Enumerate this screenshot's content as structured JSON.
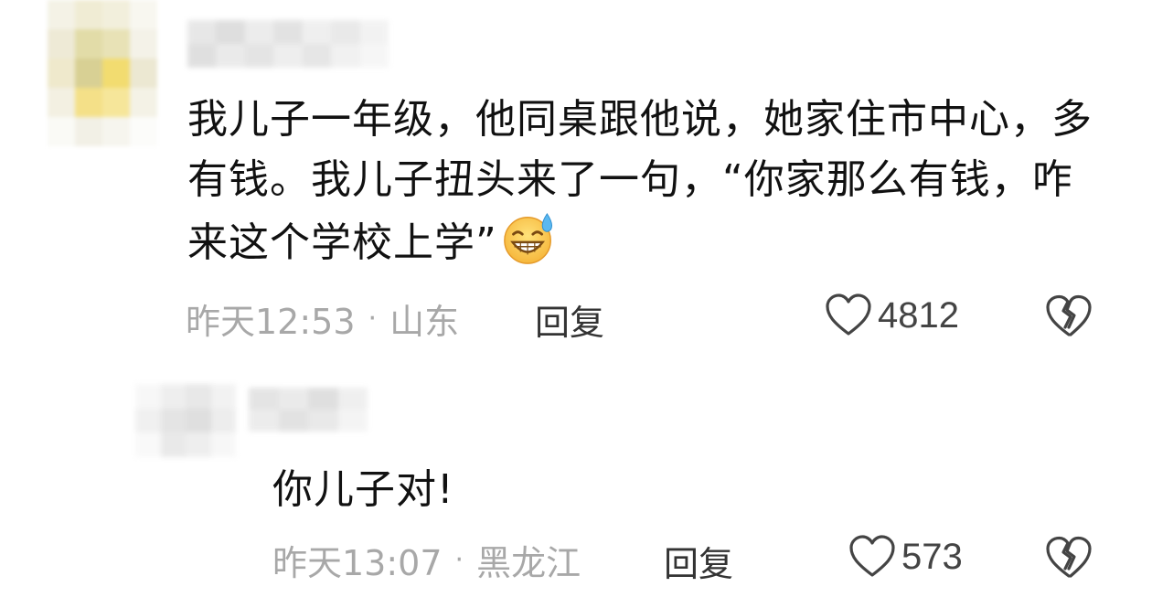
{
  "comments": [
    {
      "text": "我儿子一年级，他同桌跟他说，她家住市中心，多有钱。我儿子扭头来了一句，“你家那么有钱，咋来这个学校上学”",
      "emoji_icon": "grinning-sweat-face-icon",
      "time": "昨天12:53",
      "separator": "·",
      "location": "山东",
      "reply_label": "回复",
      "like_count": "4812"
    },
    {
      "text": "你儿子对!",
      "time": "昨天13:07",
      "separator": "·",
      "location": "黑龙江",
      "reply_label": "回复",
      "like_count": "573"
    }
  ],
  "colors": {
    "text": "#111111",
    "meta": "#a8a8a8",
    "reply": "#333333",
    "icon": "#444444"
  }
}
